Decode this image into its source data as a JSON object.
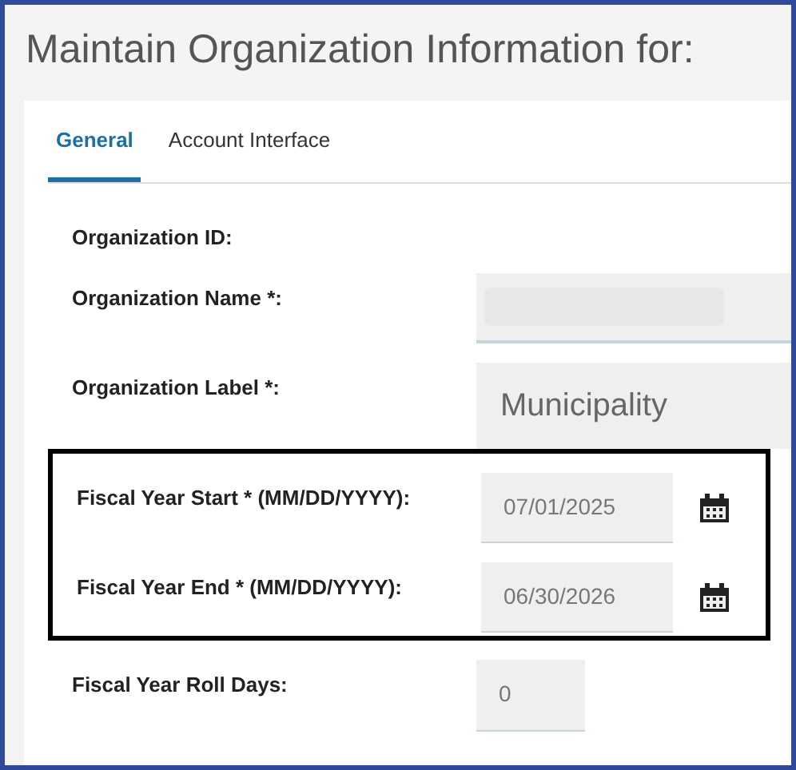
{
  "title": "Maintain Organization Information for:",
  "tabs": [
    {
      "label": "General",
      "selected": true
    },
    {
      "label": "Account Interface",
      "selected": false
    }
  ],
  "fields": [
    {
      "kind": "static",
      "label": "Organization ID:"
    },
    {
      "kind": "redacted",
      "label": "Organization Name *:"
    },
    {
      "kind": "large",
      "label": "Organization Label *:",
      "value": "Municipality"
    }
  ],
  "highlighted_fields": [
    {
      "kind": "date",
      "label": "Fiscal Year Start * (MM/DD/YYYY):",
      "value": "07/01/2025"
    },
    {
      "kind": "date",
      "label": "Fiscal Year End * (MM/DD/YYYY):",
      "value": "06/30/2026"
    }
  ],
  "after_fields": [
    {
      "kind": "small",
      "label": "Fiscal Year Roll Days:",
      "value": "0"
    }
  ]
}
